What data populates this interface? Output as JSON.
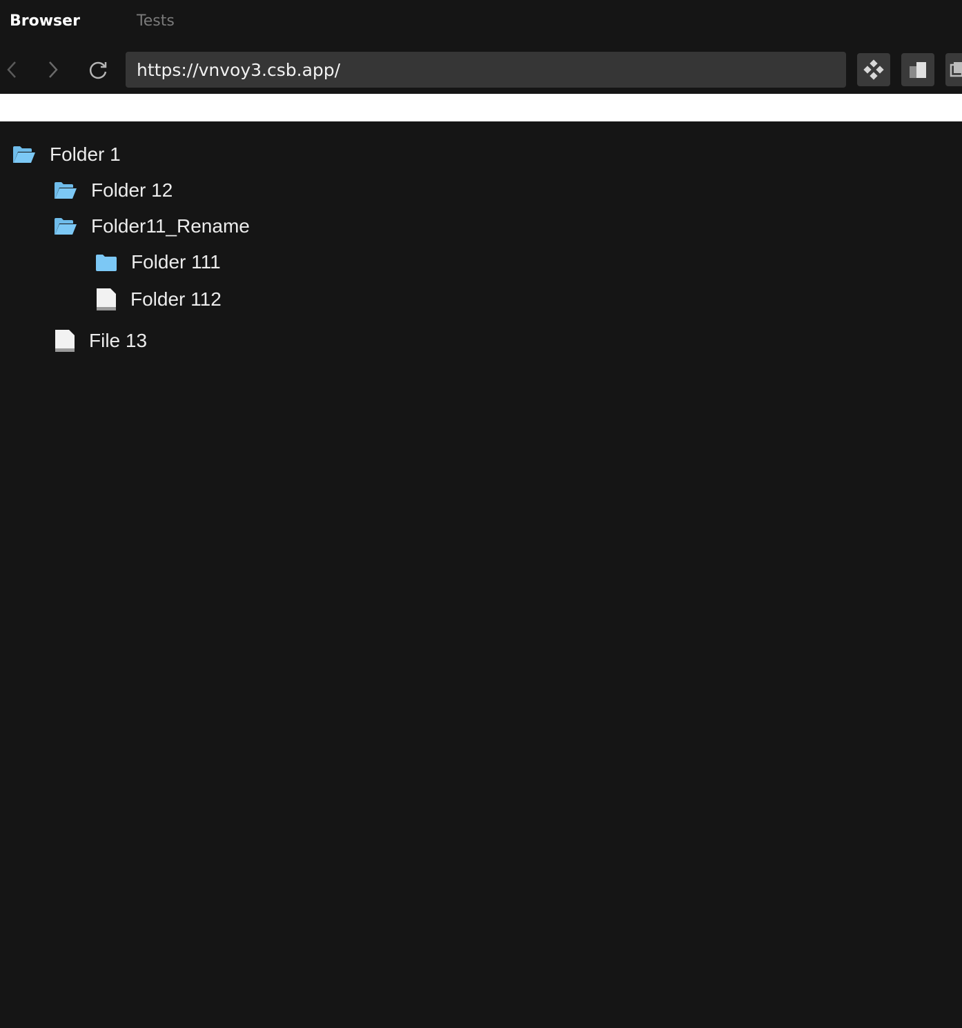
{
  "tabs": [
    {
      "label": "Browser",
      "active": true
    },
    {
      "label": "Tests",
      "active": false
    }
  ],
  "toolbar": {
    "url": "https://vnvoy3.csb.app/",
    "back_icon": "chevron-left-icon",
    "forward_icon": "chevron-right-icon",
    "reload_icon": "reload-icon",
    "tool_icons": [
      "diamond-grid-icon",
      "split-view-icon",
      "copy-icon"
    ]
  },
  "tree": [
    {
      "label": "Folder 1",
      "icon": "folder-open-icon"
    },
    {
      "label": "Folder 12",
      "icon": "folder-open-icon"
    },
    {
      "label": "Folder11_Rename",
      "icon": "folder-open-icon"
    },
    {
      "label": "Folder 111",
      "icon": "folder-icon"
    },
    {
      "label": "Folder 112",
      "icon": "file-icon"
    },
    {
      "label": "File 13",
      "icon": "file-icon"
    }
  ],
  "colors": {
    "background": "#151515",
    "folder": "#7cc8f5",
    "file": "#f2f2f2",
    "url_bar": "#363636"
  }
}
